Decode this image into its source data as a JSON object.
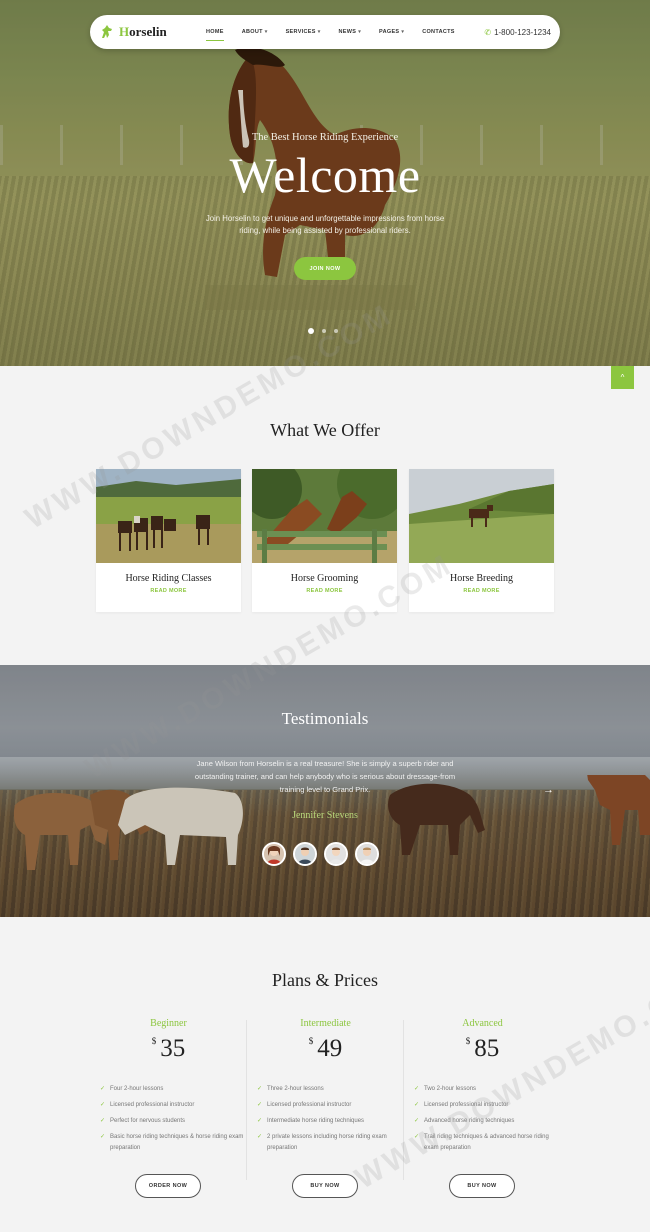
{
  "header": {
    "logo_text_first": "H",
    "logo_text_rest": "orselin",
    "nav": [
      {
        "label": "HOME",
        "active": true
      },
      {
        "label": "ABOUT",
        "dropdown": true
      },
      {
        "label": "SERVICES",
        "dropdown": true
      },
      {
        "label": "NEWS",
        "dropdown": true
      },
      {
        "label": "PAGES",
        "dropdown": true
      },
      {
        "label": "CONTACTS"
      }
    ],
    "phone": "1-800-123-1234"
  },
  "hero": {
    "tagline": "The Best Horse Riding Experience",
    "title": "Welcome",
    "description": "Join Horselin to get unique and unforgettable impressions from horse riding, while being assisted by professional riders.",
    "button": "JOIN NOW",
    "slides": 3,
    "active_slide": 1
  },
  "scroll_top_icon": "chevron-up-icon",
  "offer": {
    "title": "What We Offer",
    "cards": [
      {
        "title": "Horse Riding Classes",
        "link": "READ MORE"
      },
      {
        "title": "Horse Grooming",
        "link": "READ MORE"
      },
      {
        "title": "Horse Breeding",
        "link": "READ MORE"
      }
    ]
  },
  "testimonials": {
    "title": "Testimonials",
    "quote": "Jane Wilson from Horselin is a real treasure! She is simply a superb rider and outstanding trainer, and can help anybody who is serious about dressage-from training level to Grand Prix.",
    "name": "Jennifer Stevens",
    "next_icon": "arrow-right-icon"
  },
  "pricing": {
    "title": "Plans & Prices",
    "currency": "$",
    "plans": [
      {
        "tier": "Beginner",
        "price": "35",
        "features": [
          "Four 2-hour lessons",
          "Licensed professional instructor",
          "Perfect for nervous students",
          "Basic horse riding techniques & horse riding exam preparation"
        ],
        "button": "ORDER NOW"
      },
      {
        "tier": "Intermediate",
        "price": "49",
        "features": [
          "Three 2-hour lessons",
          "Licensed professional instructor",
          "Intermediate horse riding techniques",
          "2 private lessons including horse riding exam preparation"
        ],
        "button": "BUY NOW"
      },
      {
        "tier": "Advanced",
        "price": "85",
        "features": [
          "Two 2-hour lessons",
          "Licensed professional instructor",
          "Advanced horse riding techniques",
          "Trail riding techniques & advanced horse riding exam preparation"
        ],
        "button": "BUY NOW"
      }
    ]
  },
  "watermark": "WWW.DOWNDEMO.COM",
  "colors": {
    "accent": "#8cc63f",
    "heading": "#222222",
    "page_bg": "#f3f3f3"
  }
}
